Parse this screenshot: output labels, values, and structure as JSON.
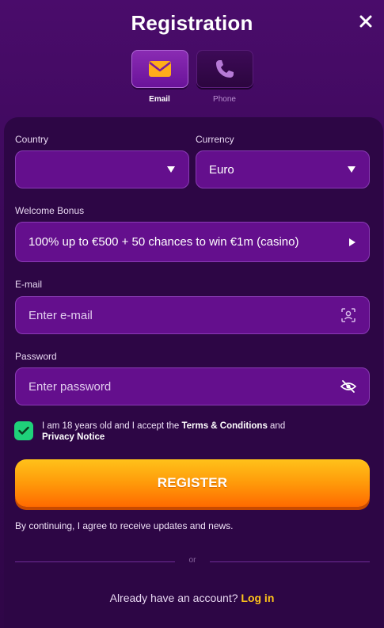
{
  "header": {
    "title": "Registration"
  },
  "tabs": [
    {
      "label": "Email",
      "icon": "envelope-icon",
      "active": true
    },
    {
      "label": "Phone",
      "icon": "phone-icon",
      "active": false
    }
  ],
  "form": {
    "country_label": "Country",
    "country_value": "",
    "currency_label": "Currency",
    "currency_value": "Euro",
    "bonus_label": "Welcome Bonus",
    "bonus_value": "100% up to €500 + 50 chances to win €1m (casino)",
    "email_label": "E-mail",
    "email_placeholder": "Enter e-mail",
    "password_label": "Password",
    "password_placeholder": "Enter password",
    "terms_prefix": "I am 18 years old and I accept the ",
    "terms_link": "Terms & Conditions",
    "terms_mid": " and ",
    "privacy_link": "Privacy Notice",
    "terms_checked": true,
    "register_label": "REGISTER",
    "updates_text": "By continuing, I agree to receive updates and news.",
    "divider_text": "or",
    "login_prompt": "Already have an account?",
    "login_link": "Log in"
  },
  "colors": {
    "accent_orange": "#ffc41a",
    "check_green": "#1fd17a",
    "field_purple": "#640f8d"
  }
}
